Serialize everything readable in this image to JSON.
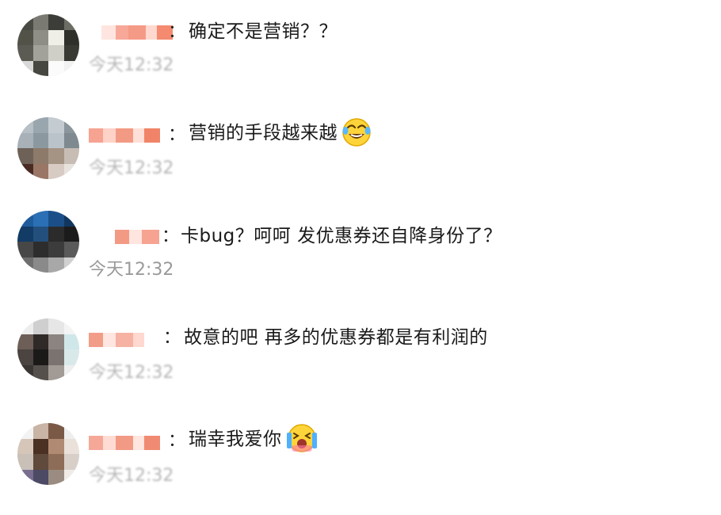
{
  "comments": [
    {
      "text": "确定不是营销？？",
      "time": "今天12:32",
      "avatar_colors": [
        "#4a4a44",
        "#7a7a72",
        "#3c3c38",
        "#6d6d66",
        "#525249",
        "#8e8e86",
        "#efefe8",
        "#2f2f2b",
        "#5b5b53",
        "#a2a29a",
        "#cfcfc8",
        "#3a3a35",
        "#d9d9d9",
        "#474741",
        "#fbfbfb",
        "#f2f2f2"
      ],
      "name_colors": [
        "#ffe5df",
        "#f7a898",
        "#f59a86",
        "#ffd9cf",
        "#f48a70"
      ],
      "emoji": ""
    },
    {
      "text": "营销的手段越来越",
      "time": "今天12:32",
      "avatar_colors": [
        "#b7c0c6",
        "#9aa6ad",
        "#c4ccd2",
        "#8a969c",
        "#a7b1b7",
        "#8c989f",
        "#b9c3c9",
        "#7e8a90",
        "#6e6158",
        "#8d7a6b",
        "#a59384",
        "#c7bdb4",
        "#4a2b24",
        "#9a7666",
        "#d8cbc3",
        "#e8e2dd"
      ],
      "name_colors": [
        "#f6a391",
        "#ffd2c8",
        "#f39a85",
        "#ffe0d8",
        "#f18468"
      ],
      "emoji": "laugh-cry-emoji"
    },
    {
      "text": "卡bug？呵呵 发优惠券还自降身份了？",
      "time": "今天12:32",
      "avatar_colors": [
        "#1f5c9c",
        "#2b6fb5",
        "#1b4f8a",
        "#12375f",
        "#123b66",
        "#234f7c",
        "#2b2b2b",
        "#1b1b1b",
        "#474747",
        "#2d2d2d",
        "#3c3c3c",
        "#5a5a5a",
        "#6e6e6e",
        "#8a8a8a",
        "#a8a8a8",
        "#d0d0d0"
      ],
      "name_colors": [
        "#f39a85",
        "#ffe5df",
        "#f6a391"
      ],
      "emoji": ""
    },
    {
      "text": "故意的吧 再多的优惠券都是有利润的",
      "time": "今天12:32",
      "avatar_colors": [
        "#ededed",
        "#cfcfcf",
        "#e6e6e6",
        "#f4f4f4",
        "#6d5f58",
        "#2f2a28",
        "#8b8480",
        "#cfe7e8",
        "#4b4441",
        "#1c1a19",
        "#7a736f",
        "#d9e9ea",
        "#3a3633",
        "#55504c",
        "#a19a95",
        "#eeeeee"
      ],
      "name_colors": [
        "#f29d88",
        "#ffe6e0",
        "#f6b2a2",
        "#ffd8cf"
      ],
      "emoji": ""
    },
    {
      "text": "瑞幸我爱你",
      "time": "今天12:32",
      "avatar_colors": [
        "#f3f3f3",
        "#c9b4a5",
        "#7a5a47",
        "#eeeeee",
        "#d6c6ba",
        "#4b3124",
        "#b08a72",
        "#e9e1da",
        "#c9c0b8",
        "#5f4a3c",
        "#8d6c58",
        "#d8cfc8",
        "#7a6e90",
        "#4d4a66",
        "#9a8c80",
        "#f0ebe6"
      ],
      "name_colors": [
        "#f6a898",
        "#ffdcd3",
        "#f39a85",
        "#ffe6df",
        "#f18a72"
      ],
      "emoji": "crying-tears-emoji"
    }
  ]
}
